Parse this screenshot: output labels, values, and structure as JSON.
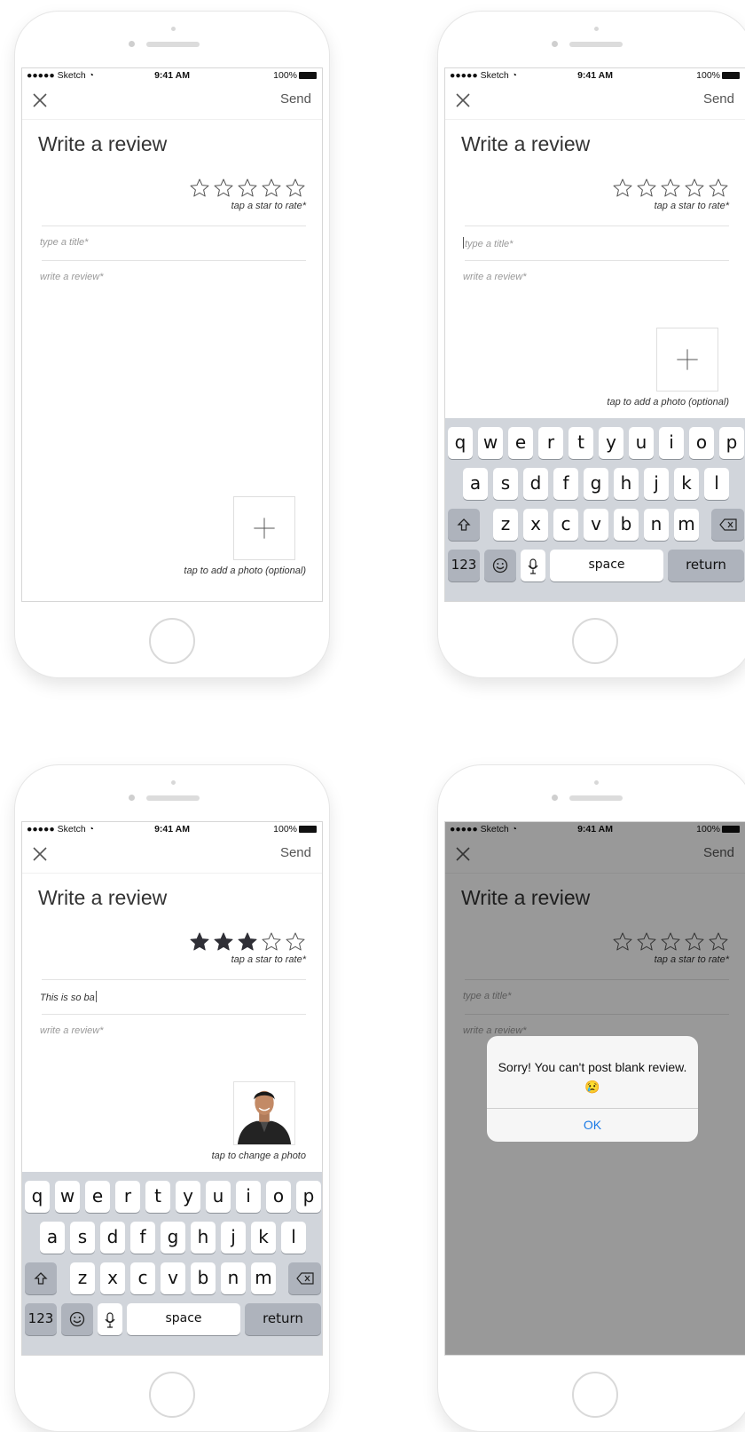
{
  "status": {
    "carrier": "●●●●● Sketch",
    "wifi_icon": "wifi-icon",
    "time": "9:41 AM",
    "battery": "100%"
  },
  "nav": {
    "close_icon": "close-icon",
    "send_label": "Send"
  },
  "form": {
    "heading": "Write a review",
    "rate_hint": "tap a star to rate*",
    "title_placeholder": "type a title*",
    "review_placeholder": "write a review*",
    "add_photo_hint": "tap to add a photo (optional)",
    "change_photo_hint": "tap to change a photo",
    "max_rating": 5
  },
  "screens": [
    {
      "id": "empty",
      "rating": 0,
      "keyboard": false
    },
    {
      "id": "typing-title",
      "rating": 0,
      "keyboard": true
    },
    {
      "id": "filled",
      "rating": 3,
      "title_value": "This is so ba",
      "keyboard": true,
      "photo": "user-photo"
    },
    {
      "id": "error",
      "rating": 0,
      "keyboard": false
    }
  ],
  "keyboard": {
    "row1": [
      "q",
      "w",
      "e",
      "r",
      "t",
      "y",
      "u",
      "i",
      "o",
      "p"
    ],
    "row2": [
      "a",
      "s",
      "d",
      "f",
      "g",
      "h",
      "j",
      "k",
      "l"
    ],
    "row3": [
      "z",
      "x",
      "c",
      "v",
      "b",
      "n",
      "m"
    ],
    "numbers_label": "123",
    "space_label": "space",
    "return_label": "return"
  },
  "alert": {
    "message": "Sorry! You can't post blank review. 😢",
    "ok_label": "OK"
  },
  "colors": {
    "star_filled": "#2f2f36",
    "link_blue": "#1a7ae6",
    "keyboard_bg": "#d1d5db"
  }
}
